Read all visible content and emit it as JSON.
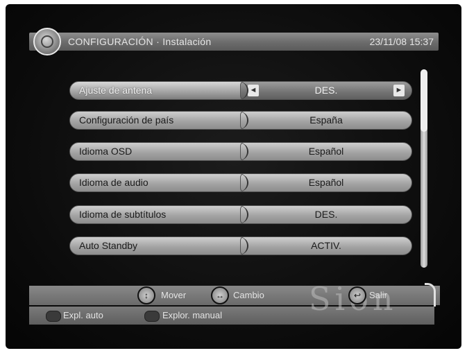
{
  "header": {
    "title": "CONFIGURACIÓN · Instalación",
    "datetime": "23/11/08  15:37"
  },
  "settings": [
    {
      "label": "Ajuste de antena",
      "value": "DES.",
      "selected": true
    },
    {
      "label": "Configuración de país",
      "value": "España",
      "selected": false
    },
    {
      "label": "Idioma OSD",
      "value": "Español",
      "selected": false
    },
    {
      "label": "Idioma de audio",
      "value": "Español",
      "selected": false
    },
    {
      "label": "Idioma de subtítulos",
      "value": "DES.",
      "selected": false
    },
    {
      "label": "Auto Standby",
      "value": "ACTIV.",
      "selected": false
    }
  ],
  "value_arrows": {
    "left": "◄",
    "right": "►"
  },
  "footer": {
    "move_label": "Mover",
    "change_label": "Cambio",
    "exit_label": "Salir",
    "auto_scan_label": "Expl. auto",
    "manual_scan_label": "Explor. manual",
    "watermark": "Sion"
  },
  "icons": {
    "header_logo": "settings-disc-icon",
    "move": "up-down-arrows-icon",
    "change": "left-right-arrows-icon",
    "exit": "exit-icon"
  }
}
